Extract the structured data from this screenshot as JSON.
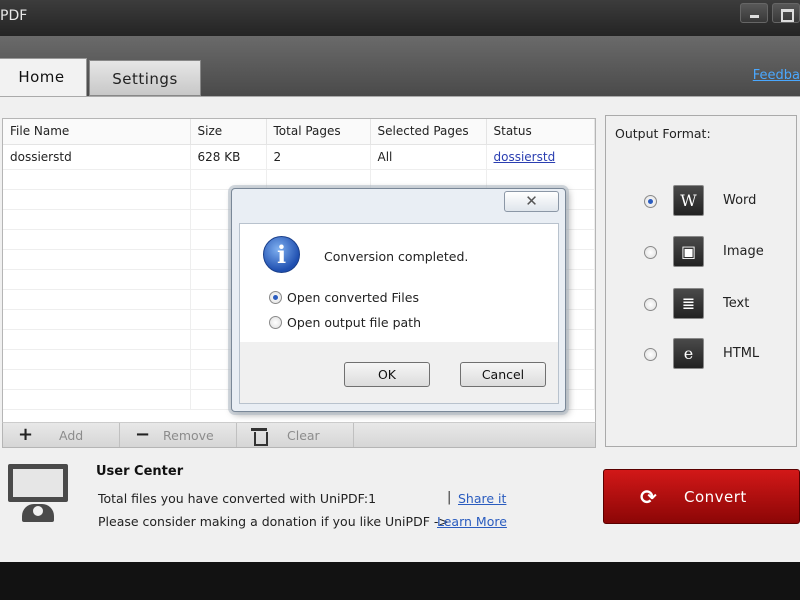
{
  "window": {
    "title": "PDF",
    "controls": [
      "minimize",
      "maximize"
    ]
  },
  "tabs": [
    {
      "label": "Home",
      "active": true
    },
    {
      "label": "Settings",
      "active": false
    }
  ],
  "feedback_link": "Feedba",
  "file_table": {
    "columns": [
      "File Name",
      "Size",
      "Total Pages",
      "Selected Pages",
      "Status"
    ],
    "rows": [
      {
        "file_name": "dossierstd",
        "size": "628 KB",
        "total_pages": "2",
        "selected_pages": "All",
        "status": "dossierstd"
      }
    ]
  },
  "file_actions": {
    "add": "Add",
    "remove": "Remove",
    "clear": "Clear"
  },
  "output_format": {
    "title": "Output Format:",
    "options": [
      {
        "label": "Word",
        "icon": "word-icon",
        "selected": true
      },
      {
        "label": "Image",
        "icon": "image-icon",
        "selected": false
      },
      {
        "label": "Text",
        "icon": "text-icon",
        "selected": false
      },
      {
        "label": "HTML",
        "icon": "html-icon",
        "selected": false
      }
    ]
  },
  "user_center": {
    "title": "User Center",
    "converted_text": "Total files you have converted with UniPDF:1",
    "donation_text": "Please consider making a donation if you like UniPDF ->",
    "separator": "|",
    "share_link": "Share it",
    "learn_more_link": "Learn More"
  },
  "convert_button": {
    "label": "Convert"
  },
  "dialog": {
    "message": "Conversion completed.",
    "options": [
      {
        "label": "Open converted Files",
        "selected": true
      },
      {
        "label": "Open output file path",
        "selected": false
      }
    ],
    "ok_label": "OK",
    "cancel_label": "Cancel"
  },
  "colors": {
    "accent_red": "#b00d0d",
    "link_blue": "#2a5cbf",
    "feedback_blue": "#4aa8ff"
  }
}
